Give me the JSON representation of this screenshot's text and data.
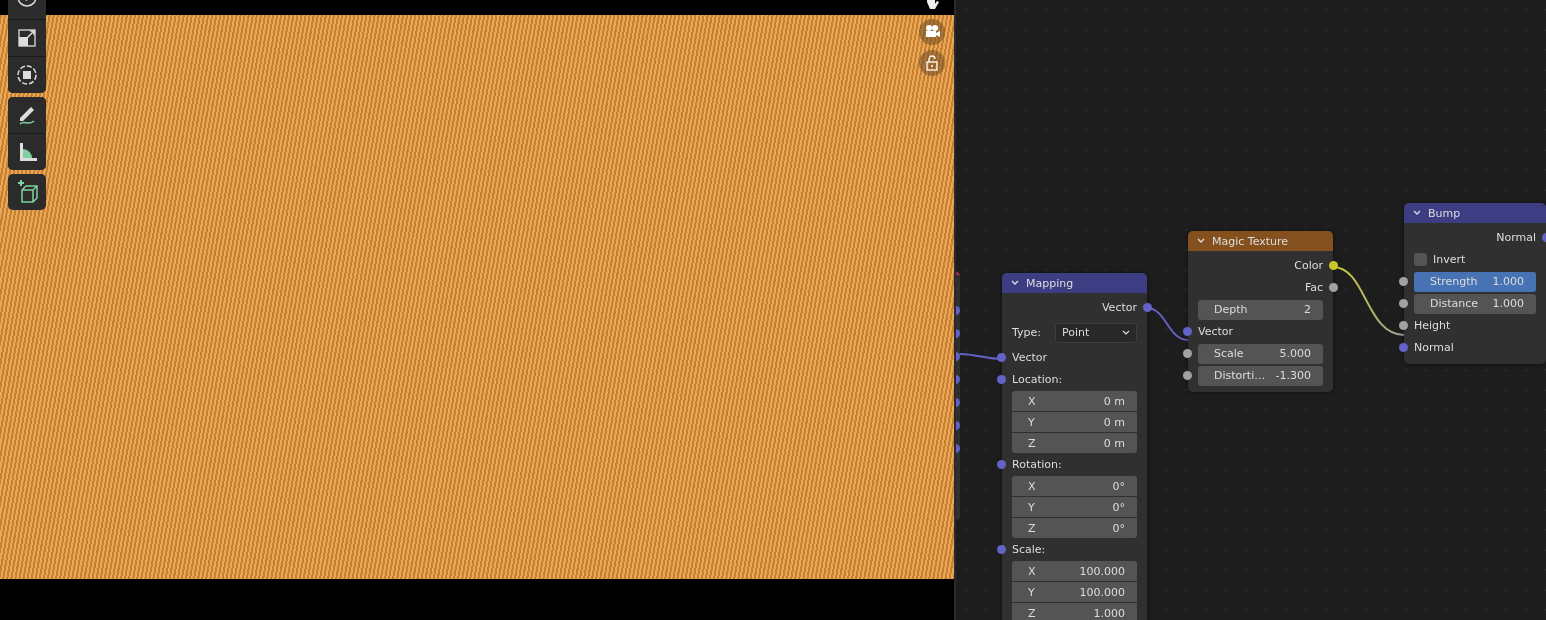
{
  "node_editor": {
    "nodes": [
      {
        "title": "Mapping",
        "color": "#3d3d84",
        "expanded": true,
        "rows": [
          {
            "kind": "output",
            "label": "Vector",
            "color": "#6363c7"
          },
          {
            "kind": "dropdown",
            "label": "Type:",
            "value": "Point"
          },
          {
            "kind": "input",
            "label": "Vector",
            "color": "#6363c7"
          },
          {
            "kind": "input",
            "label": "Location:",
            "color": "#6363c7"
          },
          {
            "kind": "vector",
            "fields": [
              {
                "axis": "X",
                "value": "0 m"
              },
              {
                "axis": "Y",
                "value": "0 m"
              },
              {
                "axis": "Z",
                "value": "0 m"
              }
            ]
          },
          {
            "kind": "input",
            "label": "Rotation:",
            "color": "#6363c7"
          },
          {
            "kind": "vector",
            "fields": [
              {
                "axis": "X",
                "value": "0°"
              },
              {
                "axis": "Y",
                "value": "0°"
              },
              {
                "axis": "Z",
                "value": "0°"
              }
            ]
          },
          {
            "kind": "input",
            "label": "Scale:",
            "color": "#6363c7"
          },
          {
            "kind": "vector",
            "fields": [
              {
                "axis": "X",
                "value": "100.000"
              },
              {
                "axis": "Y",
                "value": "100.000"
              },
              {
                "axis": "Z",
                "value": "1.000"
              }
            ]
          }
        ]
      },
      {
        "title": "Magic Texture",
        "color": "#84501e",
        "expanded": true,
        "rows": [
          {
            "kind": "output",
            "label": "Color",
            "color": "#c7c729"
          },
          {
            "kind": "output",
            "label": "Fac",
            "color": "#a1a1a1"
          },
          {
            "kind": "field",
            "label": "Depth",
            "value": "2"
          },
          {
            "kind": "input",
            "label": "Vector",
            "color": "#6363c7"
          },
          {
            "kind": "field",
            "label": "Scale",
            "value": "5.000",
            "color": "#a1a1a1"
          },
          {
            "kind": "field",
            "label": "Distorti…",
            "value": "-1.300",
            "color": "#a1a1a1"
          }
        ]
      },
      {
        "title": "Bump",
        "color": "#3d3d84",
        "expanded": true,
        "rows": [
          {
            "kind": "output",
            "label": "Normal",
            "color": "#6363c7"
          },
          {
            "kind": "checkbox",
            "label": "Invert",
            "checked": false
          },
          {
            "kind": "slider",
            "label": "Strength",
            "value": "1.000",
            "level": 1,
            "color": "#a1a1a1"
          },
          {
            "kind": "field",
            "label": "Distance",
            "value": "1.000",
            "color": "#a1a1a1"
          },
          {
            "kind": "input",
            "label": "Height",
            "color": "#a1a1a1"
          },
          {
            "kind": "input",
            "label": "Normal",
            "color": "#6363c7"
          }
        ]
      }
    ]
  }
}
